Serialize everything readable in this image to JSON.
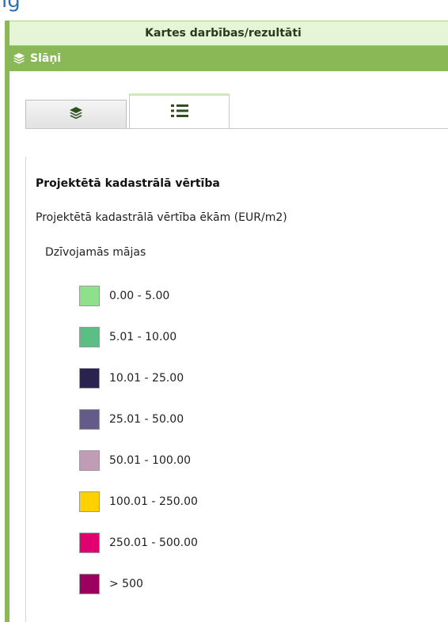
{
  "top_cut_text": "ig",
  "panel": {
    "title": "Kartes darbības/rezultāti",
    "layers_label": "Slāņi",
    "layers_icon": "layers-icon"
  },
  "tabs": [
    {
      "icon": "layers-icon",
      "active": false
    },
    {
      "icon": "list-icon",
      "active": true
    }
  ],
  "legend": {
    "title": "Projektētā kadastrālā vērtība",
    "subtitle": "Projektētā kadastrālā vērtība ēkām (EUR/m2)",
    "group": "Dzīvojamās mājas",
    "items": [
      {
        "label": "0.00 - 5.00",
        "color": "#8fe08c"
      },
      {
        "label": "5.01 - 10.00",
        "color": "#5bbf85"
      },
      {
        "label": "10.01 - 25.00",
        "color": "#2a2350"
      },
      {
        "label": "25.01 - 50.00",
        "color": "#645b8b"
      },
      {
        "label": "50.01 - 100.00",
        "color": "#c09cb5"
      },
      {
        "label": "100.01 - 250.00",
        "color": "#ffd100"
      },
      {
        "label": "250.01 - 500.00",
        "color": "#e0006e"
      },
      {
        "label": "> 500",
        "color": "#9b0061"
      }
    ]
  },
  "colors": {
    "accent_green": "#8ab856",
    "header_bg": "#e5f5d5"
  }
}
